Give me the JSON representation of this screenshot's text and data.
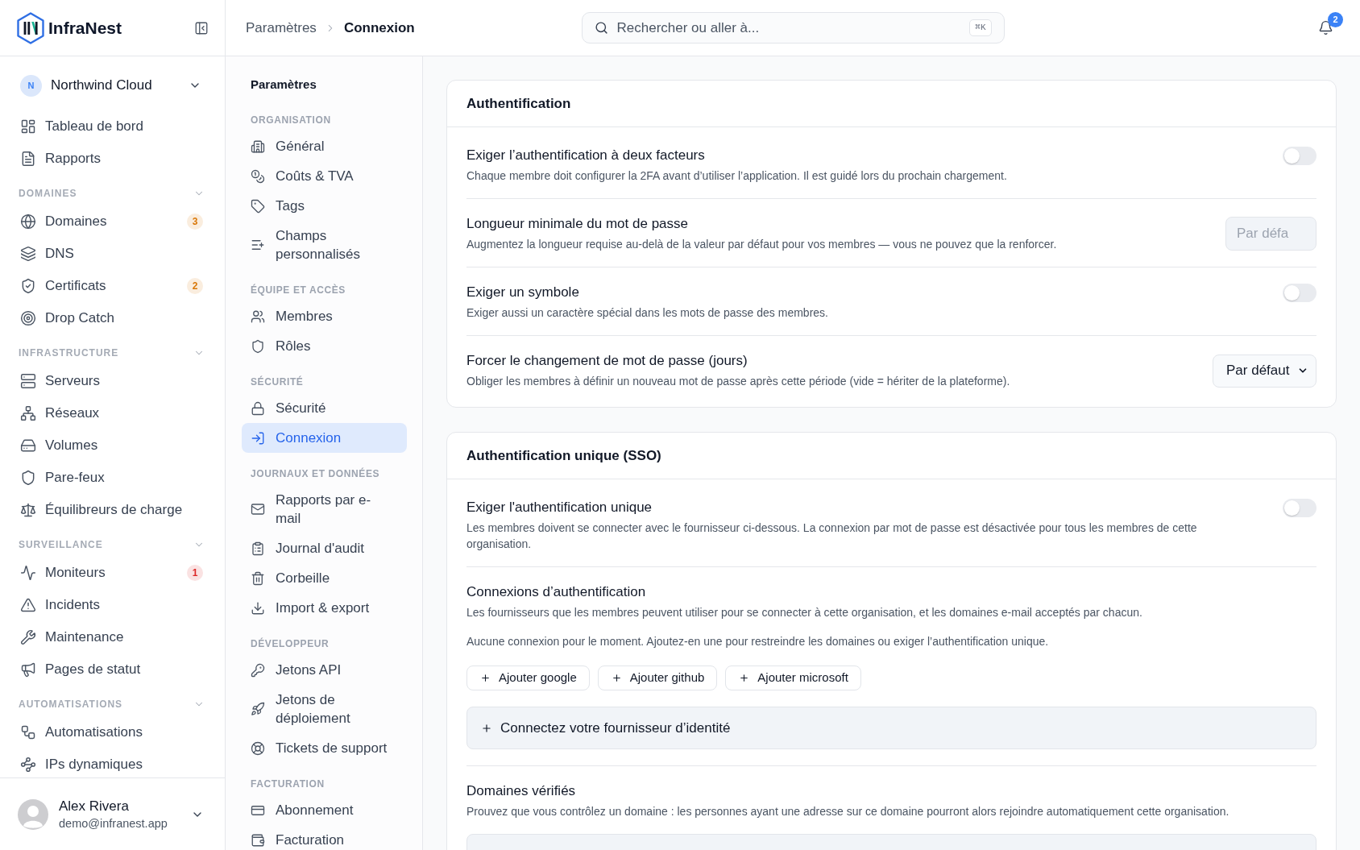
{
  "sidebar": {
    "brand": "InfraNest",
    "org": {
      "initial": "N",
      "name": "Northwind Cloud"
    },
    "items": [
      {
        "label": "Tableau de bord",
        "selected": false
      },
      {
        "label": "Rapports",
        "selected": false
      }
    ],
    "sections": [
      {
        "title": "DOMAINES",
        "expanded": true,
        "items": [
          {
            "label": "Domaines",
            "selected": false,
            "badge": {
              "text": "3",
              "color": "#d97706"
            }
          },
          {
            "label": "DNS",
            "selected": false
          },
          {
            "label": "Certificats",
            "selected": false,
            "badge": {
              "text": "2",
              "color": "#d97706"
            }
          },
          {
            "label": "Drop Catch",
            "selected": false
          }
        ]
      },
      {
        "title": "INFRASTRUCTURE",
        "expanded": true,
        "items": [
          {
            "label": "Serveurs",
            "selected": false
          },
          {
            "label": "Réseaux",
            "selected": false
          },
          {
            "label": "Volumes",
            "selected": false
          },
          {
            "label": "Pare-feux",
            "selected": false
          },
          {
            "label": "Équilibreurs de charge",
            "selected": false
          }
        ]
      },
      {
        "title": "SURVEILLANCE",
        "expanded": true,
        "items": [
          {
            "label": "Moniteurs",
            "selected": false,
            "badge": {
              "text": "1",
              "color": "#dc2626"
            }
          },
          {
            "label": "Incidents",
            "selected": false
          },
          {
            "label": "Maintenance",
            "selected": false
          },
          {
            "label": "Pages de statut",
            "selected": false
          }
        ]
      },
      {
        "title": "AUTOMATISATIONS",
        "expanded": true,
        "items": [
          {
            "label": "Automatisations",
            "selected": false
          },
          {
            "label": "IPs dynamiques",
            "selected": false
          }
        ]
      }
    ],
    "user": {
      "name": "Alex Rivera",
      "email": "demo@infranest.app"
    }
  },
  "topbar": {
    "breadcrumb": [
      {
        "label": "Paramètres"
      },
      {
        "label": "Connexion"
      }
    ],
    "search": {
      "placeholder": "Rechercher ou aller à...",
      "shortcut": "⌘K"
    },
    "notifications": {
      "count": "2"
    }
  },
  "settings_nav": {
    "title": "Paramètres",
    "sections": [
      {
        "title": "ORGANISATION",
        "items": [
          {
            "label": "Général",
            "selected": false
          },
          {
            "label": "Coûts & TVA",
            "selected": false
          },
          {
            "label": "Tags",
            "selected": false
          },
          {
            "label": "Champs personnalisés",
            "selected": false
          }
        ]
      },
      {
        "title": "ÉQUIPE ET ACCÈS",
        "items": [
          {
            "label": "Membres",
            "selected": false
          },
          {
            "label": "Rôles",
            "selected": false
          }
        ]
      },
      {
        "title": "SÉCURITÉ",
        "items": [
          {
            "label": "Sécurité",
            "selected": false
          },
          {
            "label": "Connexion",
            "selected": true
          }
        ]
      },
      {
        "title": "JOURNAUX ET DONNÉES",
        "items": [
          {
            "label": "Rapports par e-mail",
            "selected": false
          },
          {
            "label": "Journal d'audit",
            "selected": false
          },
          {
            "label": "Corbeille",
            "selected": false
          },
          {
            "label": "Import & export",
            "selected": false
          }
        ]
      },
      {
        "title": "DÉVELOPPEUR",
        "items": [
          {
            "label": "Jetons API",
            "selected": false
          },
          {
            "label": "Jetons de déploiement",
            "selected": false
          },
          {
            "label": "Tickets de support",
            "selected": false
          }
        ]
      },
      {
        "title": "FACTURATION",
        "items": [
          {
            "label": "Abonnement",
            "selected": false
          },
          {
            "label": "Facturation",
            "selected": false
          }
        ]
      }
    ]
  },
  "cards": [
    {
      "title": "Authentification",
      "rows": [
        {
          "kind": "toggle",
          "title": "Exiger l’authentification à deux facteurs",
          "description": "Chaque membre doit configurer la 2FA avant d’utiliser l’application. Il est guidé lors du prochain chargement.",
          "on": false
        },
        {
          "kind": "input",
          "title": "Longueur minimale du mot de passe",
          "description": "Augmentez la longueur requise au-delà de la valeur par défaut pour vos membres — vous ne pouvez que la renforcer.",
          "placeholder": "Par défa"
        },
        {
          "kind": "toggle",
          "title": "Exiger un symbole",
          "description": "Exiger aussi un caractère spécial dans les mots de passe des membres.",
          "on": false
        },
        {
          "kind": "select",
          "title": "Forcer le changement de mot de passe (jours)",
          "description": "Obliger les membres à définir un nouveau mot de passe après cette période (vide = hériter de la plateforme).",
          "value": "Par défaut"
        }
      ]
    },
    {
      "title": "Authentification unique (SSO)",
      "rows": [
        {
          "kind": "toggle",
          "title": "Exiger l'authentification unique",
          "description": "Les membres doivent se connecter avec le fournisseur ci-dessous. La connexion par mot de passe est désactivée pour tous les membres de cette organisation.",
          "on": false
        },
        {
          "kind": "connections",
          "title": "Connexions d’authentification",
          "description": "Les fournisseurs que les membres peuvent utiliser pour se connecter à cette organisation, et les domaines e-mail acceptés par chacun.",
          "empty_text": "Aucune connexion pour le moment. Ajoutez-en une pour restreindre les domaines ou exiger l’authentification unique.",
          "buttons": [
            {
              "label": "Ajouter google"
            },
            {
              "label": "Ajouter github"
            },
            {
              "label": "Ajouter microsoft"
            }
          ],
          "provider_button": {
            "label": "Connectez votre fournisseur d’identité"
          }
        },
        {
          "kind": "domains",
          "title": "Domaines vérifiés",
          "description": "Prouvez que vous contrôlez un domaine : les personnes ayant une adresse sur ce domaine pourront alors rejoindre automatiquement cette organisation."
        }
      ]
    }
  ]
}
